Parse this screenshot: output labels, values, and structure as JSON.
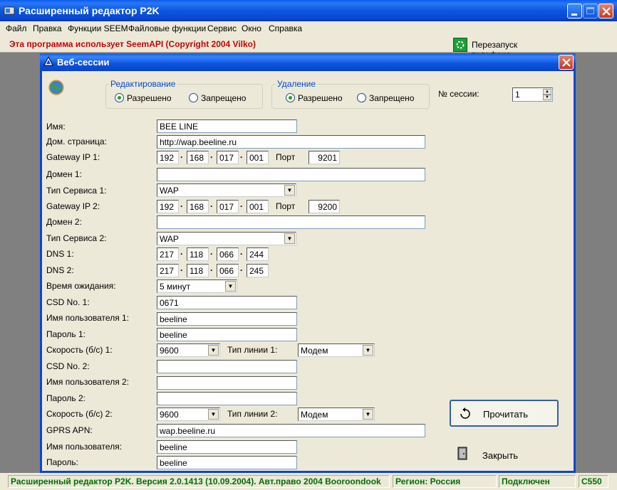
{
  "window": {
    "title": "Расширенный редактор P2K"
  },
  "menu": [
    "Файл",
    "Правка",
    "Функции SEEM",
    "Файловые функции",
    "Сервис",
    "Окно",
    "Справка"
  ],
  "infobar": {
    "copyright": "Эта программа использует SeemAPI (Copyright 2004 Vilko)",
    "restart_label": "Перезапуск телефона"
  },
  "child": {
    "title": "Веб-сессии",
    "editing": {
      "title": "Редактирование",
      "allowed": "Разрешено",
      "denied": "Запрещено",
      "selected": "allowed"
    },
    "deleting": {
      "title": "Удаление",
      "allowed": "Разрешено",
      "denied": "Запрещено",
      "selected": "allowed"
    },
    "session_label": "№ сессии:",
    "session_value": "1",
    "labels": {
      "name": "Имя:",
      "homepage": "Дом. страница:",
      "gw1": "Gateway IP 1:",
      "port": "Порт",
      "domain1": "Домен 1:",
      "service1": "Тип Сервиса 1:",
      "gw2": "Gateway IP 2:",
      "domain2": "Домен 2:",
      "service2": "Тип Сервиса 2:",
      "dns1": "DNS 1:",
      "dns2": "DNS 2:",
      "timeout": "Время ожидания:",
      "csd1": "CSD No. 1:",
      "user1": "Имя пользователя 1:",
      "pass1": "Пароль 1:",
      "speed1": "Скорость (б/с) 1:",
      "line1": "Тип линии 1:",
      "csd2": "CSD No. 2:",
      "user2": "Имя пользователя 2:",
      "pass2": "Пароль 2:",
      "speed2": "Скорость (б/с) 2:",
      "line2": "Тип линии 2:",
      "apn": "GPRS APN:",
      "user": "Имя пользователя:",
      "pass": "Пароль:"
    },
    "values": {
      "name": "BEE LINE",
      "homepage": "http://wap.beeline.ru",
      "gw1": [
        "192",
        "168",
        "017",
        "001"
      ],
      "port1": "9201",
      "domain1": "",
      "service1": "WAP",
      "gw2": [
        "192",
        "168",
        "017",
        "001"
      ],
      "port2": "9200",
      "domain2": "",
      "service2": "WAP",
      "dns1": [
        "217",
        "118",
        "066",
        "244"
      ],
      "dns2": [
        "217",
        "118",
        "066",
        "245"
      ],
      "timeout": "5 минут",
      "csd1": "0671",
      "user1": "beeline",
      "pass1": "beeline",
      "speed1": "9600",
      "line1": "Модем",
      "csd2": "",
      "user2": "",
      "pass2": "",
      "speed2": "9600",
      "line2": "Модем",
      "apn": "wap.beeline.ru",
      "user": "beeline",
      "pass": "beeline"
    },
    "read_button": "Прочитать",
    "close_button": "Закрыть"
  },
  "status": {
    "version": "Расширенный редактор P2K. Версия 2.0.1413 (10.09.2004). Авт.право 2004 Booroondook",
    "region": "Регион: Россия",
    "connection": "Подключен",
    "model": "C550"
  },
  "colors": {
    "title_blue": "#0a5cee",
    "accent": "#0046d5",
    "status_green": "#007000",
    "copyright_red": "#cc0000"
  }
}
